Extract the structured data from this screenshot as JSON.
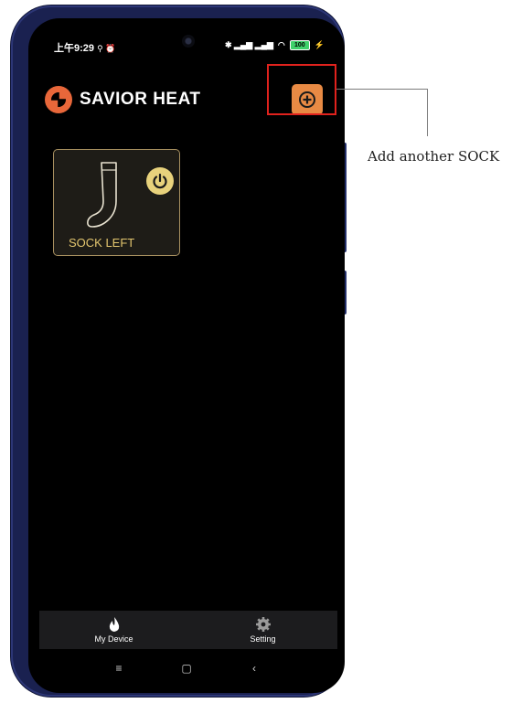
{
  "status_bar": {
    "time": "上午9:29",
    "notice_icons": "⚲ ⏰",
    "signal_icons": "✱ ▂▄▆ ▂▄▆",
    "wifi": "◠",
    "battery": "100"
  },
  "app": {
    "brand_name": "SAVIOR HEAT"
  },
  "device": {
    "label": "SOCK LEFT"
  },
  "bottom_nav": {
    "items": [
      {
        "label": "My Device",
        "icon": "flame-icon"
      },
      {
        "label": "Setting",
        "icon": "gear-icon"
      }
    ]
  },
  "system_nav": {
    "menu": "≡",
    "home": "▢",
    "back": "‹"
  },
  "annotation": {
    "text": "Add another SOCK"
  },
  "colors": {
    "accent_orange": "#e88a44",
    "card_border": "#a89060",
    "label_gold": "#e3c66f",
    "highlight_red": "#e0221d",
    "phone_frame": "#1a2150"
  }
}
